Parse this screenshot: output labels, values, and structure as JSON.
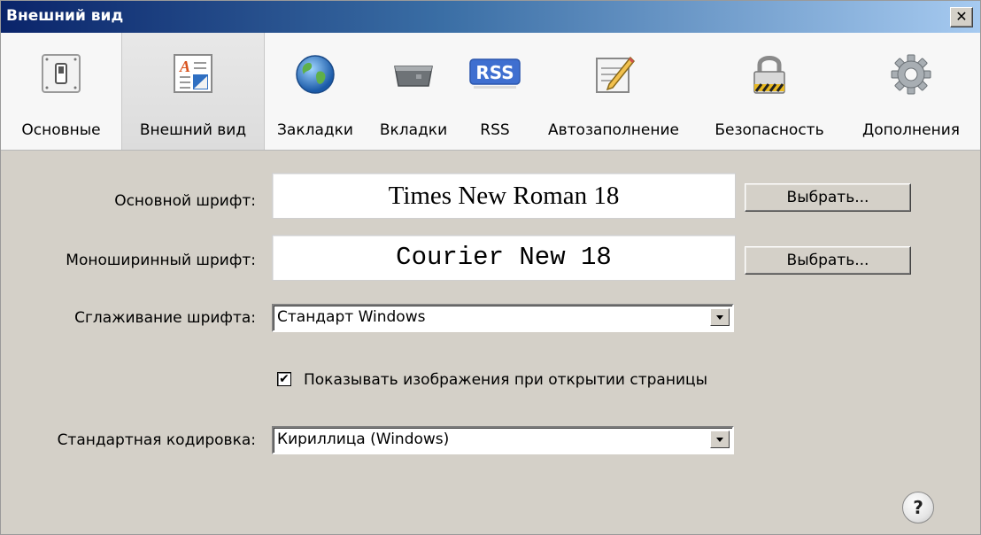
{
  "window": {
    "title": "Внешний вид",
    "close_glyph": "✕"
  },
  "toolbar": {
    "items": [
      {
        "label": "Основные",
        "icon": "general-switch-icon"
      },
      {
        "label": "Внешний вид",
        "icon": "appearance-icon",
        "selected": true
      },
      {
        "label": "Закладки",
        "icon": "globe-icon"
      },
      {
        "label": "Вкладки",
        "icon": "tab-icon"
      },
      {
        "label": "RSS",
        "icon": "rss-icon",
        "badge_text": "RSS"
      },
      {
        "label": "Автозаполнение",
        "icon": "autofill-pencil-icon"
      },
      {
        "label": "Безопасность",
        "icon": "padlock-icon"
      },
      {
        "label": "Дополнения",
        "icon": "gear-icon"
      }
    ]
  },
  "appearance": {
    "standard_font": {
      "label": "Основной шрифт:",
      "value": "Times New Roman 18",
      "button": "Выбрать..."
    },
    "fixed_font": {
      "label": "Моноширинный шрифт:",
      "value": "Courier New 18",
      "button": "Выбрать..."
    },
    "smoothing": {
      "label": "Сглаживание шрифта:",
      "value": "Стандарт Windows"
    },
    "show_images": {
      "label": "Показывать изображения при открытии страницы",
      "checked": true
    },
    "encoding": {
      "label": "Стандартная кодировка:",
      "value": "Кириллица (Windows)"
    }
  },
  "help": {
    "glyph": "?"
  },
  "colors": {
    "title_start": "#0a246a",
    "title_end": "#a6caf0",
    "dialog_bg": "#d4d0c8",
    "toolbar_bg": "#f7f7f7",
    "rss_badge": "#3f6fd0"
  }
}
